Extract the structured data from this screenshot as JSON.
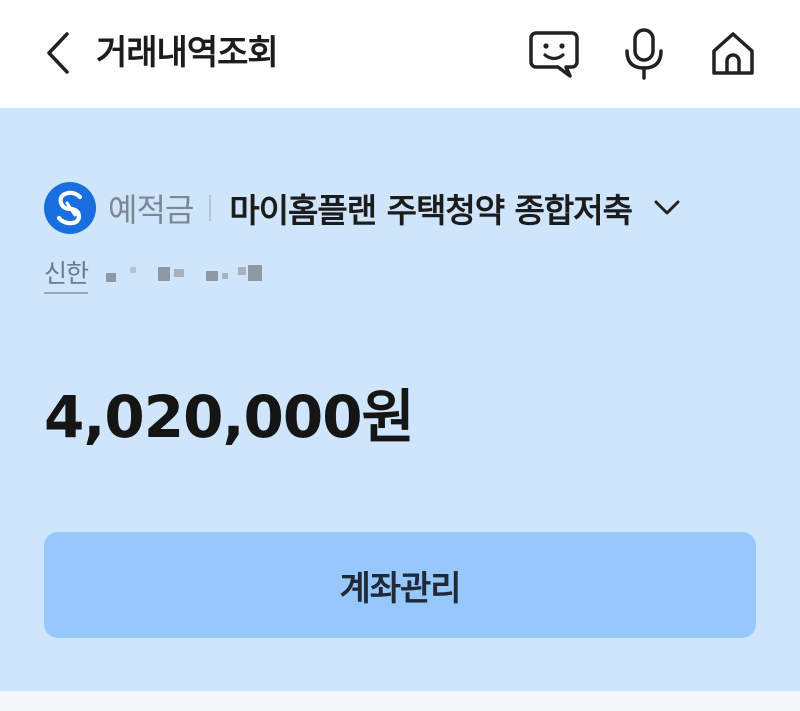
{
  "header": {
    "title": "거래내역조회",
    "icons": [
      "back-icon",
      "chatbot-icon",
      "microphone-icon",
      "home-icon"
    ]
  },
  "account": {
    "product_type": "예적금",
    "product_name": "마이홈플랜 주택청약 종합저축",
    "bank_name": "신한",
    "balance": "4,020,000원",
    "manage_button": "계좌관리"
  },
  "colors": {
    "card_background": "#cfe5fb",
    "button_background": "#97c8fb",
    "bank_logo": "#1a6fe0"
  }
}
